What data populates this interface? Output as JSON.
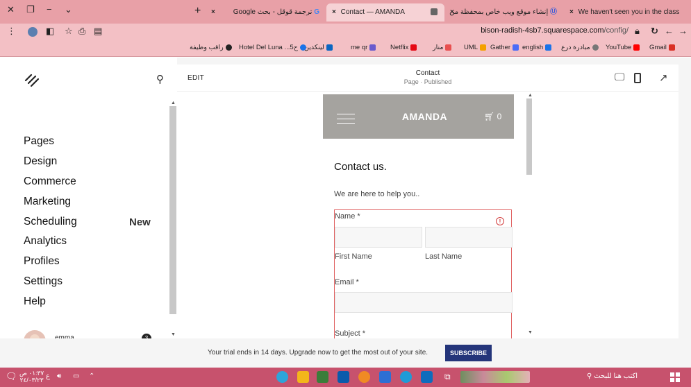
{
  "browser": {
    "tabs": [
      {
        "label": "We haven't seen you in the class",
        "icon": "gmail-icon"
      },
      {
        "label": "إنشاء موقع ويب خاص بمحفظة من",
        "icon": "u-icon"
      },
      {
        "label": "Contact — AMANDA",
        "icon": "squarespace-icon"
      },
      {
        "label": "ترجمة قوقل - بحث Google",
        "icon": "google-icon"
      }
    ],
    "new_tab": "+",
    "url_host": "bison-radish-4sb7.squarespace.com",
    "url_path": "/config/",
    "bookmarks": [
      {
        "label": "Gmail",
        "color": "#d93025"
      },
      {
        "label": "YouTube",
        "color": "#ff0000"
      },
      {
        "label": "مبادرة درع",
        "color": "#777777"
      },
      {
        "label": "english",
        "color": "#1a73e8"
      },
      {
        "label": "Gather",
        "color": "#4a6cf7"
      },
      {
        "label": "UML",
        "color": "#f4a100"
      },
      {
        "label": "منار",
        "color": "#e85050"
      },
      {
        "label": "Netflix",
        "color": "#e50914"
      },
      {
        "label": "me qr",
        "color": "#6a5acd"
      },
      {
        "label": "لينكدين",
        "color": "#0a66c2"
      },
      {
        "label": "Hotel Del Luna ...5ح",
        "color": "#1a73e8"
      },
      {
        "label": "راقب وظيفة",
        "color": "#222222"
      }
    ]
  },
  "sidebar": {
    "items": [
      {
        "label": "Pages"
      },
      {
        "label": "Design"
      },
      {
        "label": "Commerce"
      },
      {
        "label": "Marketing"
      },
      {
        "label": "Scheduling"
      },
      {
        "label": "Analytics"
      },
      {
        "label": "Profiles"
      },
      {
        "label": "Settings"
      },
      {
        "label": "Help"
      }
    ],
    "new_badge": "New",
    "user_name": "emma .",
    "notification_count": "3"
  },
  "editor": {
    "edit_label": "EDIT",
    "page_title": "Contact",
    "page_status": "Page · Published"
  },
  "site": {
    "title": "AMANDA",
    "cart_count": "0",
    "heading": "Contact us.",
    "subheading": "We are here to help you..",
    "form": {
      "name_label": "Name *",
      "first_name": "First Name",
      "last_name": "Last Name",
      "email_label": "Email *",
      "subject_label": "Subject *"
    }
  },
  "trial": {
    "text": "Your trial ends in 14 days. Upgrade now to get the most out of your site.",
    "button": "SUBSCRIBE"
  },
  "taskbar": {
    "search_placeholder": "اكتب هنا للبحث",
    "time": "٠١:٣٧ ص",
    "date": "٢٤/٠٣/٢٣",
    "lang": "ع"
  }
}
